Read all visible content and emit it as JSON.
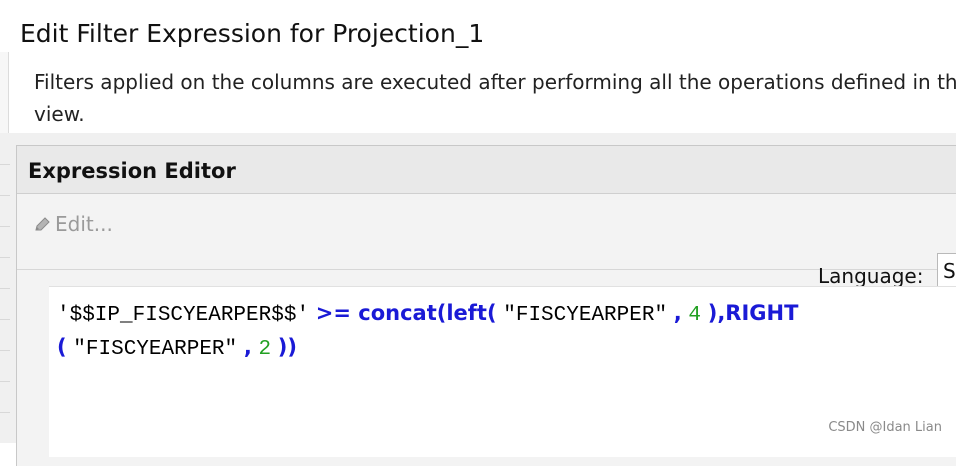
{
  "dialog": {
    "title": "Edit Filter Expression for Projection_1",
    "description": "Filters applied on the columns are executed after performing all the operations defined in the view."
  },
  "editor": {
    "panel_title": "Expression Editor",
    "toolbar": {
      "edit_label": "Edit...",
      "language_label": "Language:",
      "language_value": "SQL"
    },
    "code_lines": [
      [
        {
          "text": "'$$IP_FISCYEARPER$$'",
          "type": "string"
        },
        {
          "text": ">= ",
          "type": "operator"
        },
        {
          "text": "concat(left(",
          "type": "function"
        },
        {
          "text": "\"FISCYEARPER\"",
          "type": "string"
        },
        {
          "text": ",",
          "type": "operator"
        },
        {
          "text": "4",
          "type": "number"
        },
        {
          "text": "),RIGHT",
          "type": "function"
        }
      ],
      [
        {
          "text": "(",
          "type": "function"
        },
        {
          "text": "\"FISCYEARPER\"",
          "type": "string"
        },
        {
          "text": ",",
          "type": "operator"
        },
        {
          "text": "2",
          "type": "number"
        },
        {
          "text": "))",
          "type": "function"
        }
      ]
    ]
  },
  "watermark": "CSDN @Idan Lian",
  "icons": {
    "edit_icon": "pencil-icon"
  },
  "colors": {
    "keyword": "#1A1AD6",
    "number": "#22A022",
    "string": "#000000",
    "disabled_text": "#9A9A9A"
  }
}
